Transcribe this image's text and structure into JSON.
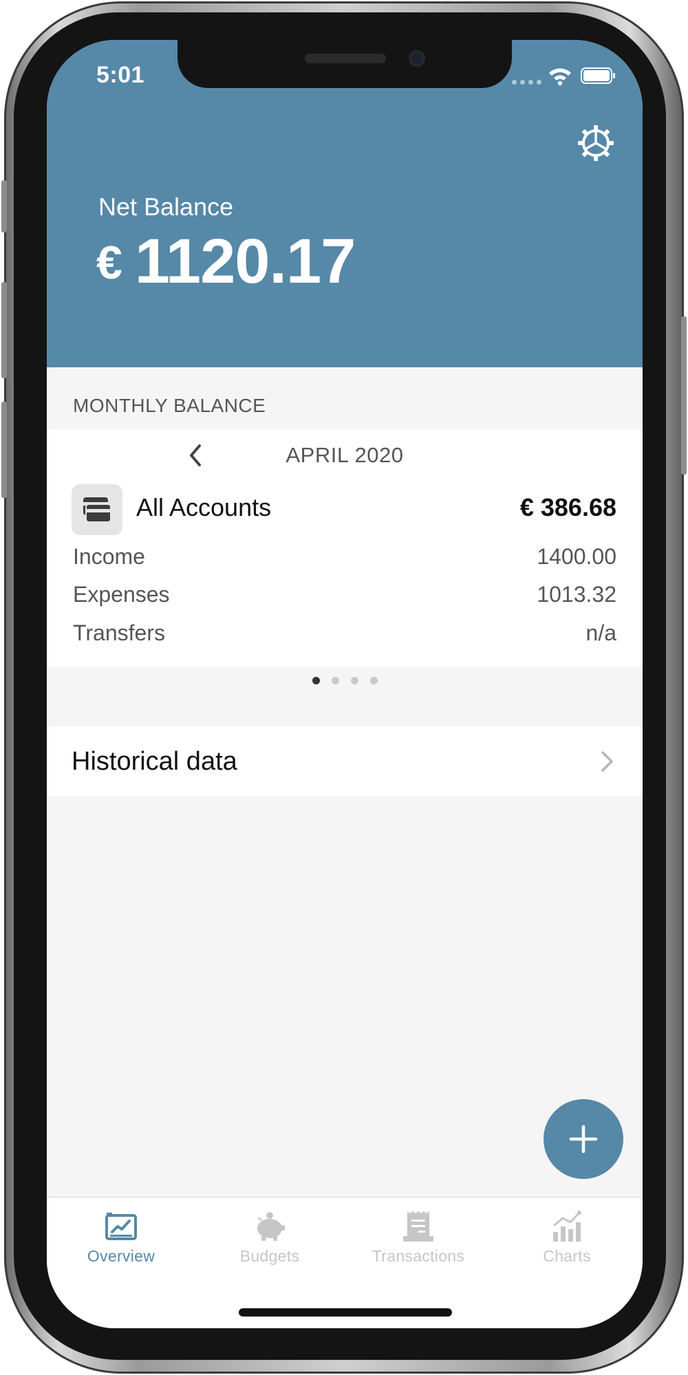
{
  "status_bar": {
    "time": "5:01"
  },
  "header": {
    "net_balance_label": "Net Balance",
    "currency": "€",
    "net_balance_value": "1120.17",
    "settings_icon": "gear-icon"
  },
  "monthly_balance": {
    "section_label": "MONTHLY BALANCE",
    "month": "APRIL 2020",
    "account": {
      "name": "All Accounts",
      "balance": "€ 386.68",
      "icon": "credit-card-icon"
    },
    "rows": [
      {
        "label": "Income",
        "value": "1400.00"
      },
      {
        "label": "Expenses",
        "value": "1013.32"
      },
      {
        "label": "Transfers",
        "value": "n/a"
      }
    ],
    "pages": {
      "count": 4,
      "current": 1
    }
  },
  "historical": {
    "label": "Historical data"
  },
  "tabs": [
    {
      "label": "Overview",
      "icon": "overview-chart-icon",
      "active": true
    },
    {
      "label": "Budgets",
      "icon": "piggy-bank-icon",
      "active": false
    },
    {
      "label": "Transactions",
      "icon": "receipt-icon",
      "active": false
    },
    {
      "label": "Charts",
      "icon": "bar-chart-icon",
      "active": false
    }
  ],
  "colors": {
    "accent": "#5688a8",
    "inactive_tab": "#c6c6c6",
    "background": "#f5f5f5"
  }
}
